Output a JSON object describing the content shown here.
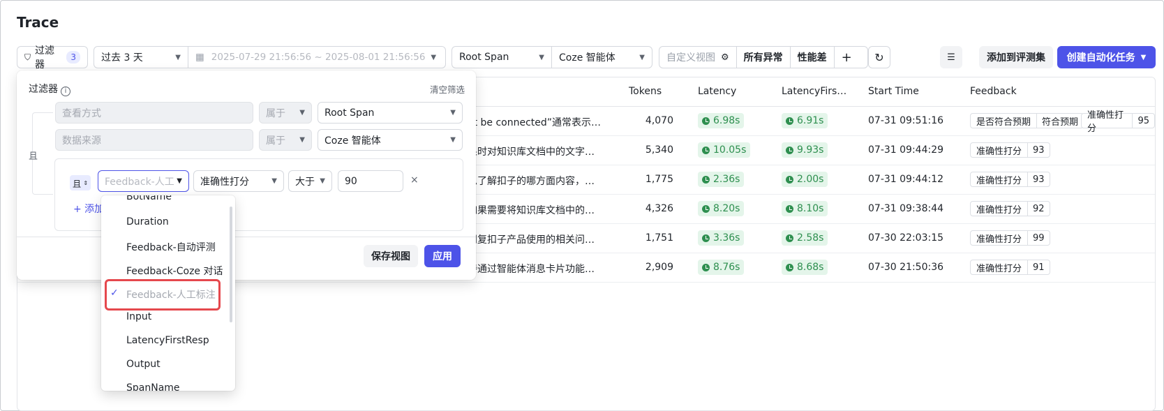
{
  "page": {
    "title": "Trace"
  },
  "toolbar": {
    "filter_label": "过滤器",
    "filter_count": "3",
    "range": "过去 3 天",
    "date_range": "2025-07-29 21:56:56 ~ 2025-08-01 21:56:56",
    "span_type": "Root Span",
    "source": "Coze 智能体",
    "custom_view_placeholder": "自定义视图",
    "view_all_errors": "所有异常",
    "view_perf": "性能差",
    "add_eval": "添加到评测集",
    "create_task": "创建自动化任务"
  },
  "table": {
    "columns": [
      "Tokens",
      "Latency",
      "LatencyFirs…",
      "Start Time",
      "Feedback"
    ],
    "rows": [
      {
        "input": "ot be connected”通常表示…",
        "tokens": "4,070",
        "latency": "6.98s",
        "latency_first": "6.91s",
        "start": "07-31 09:51:16",
        "feedback": [
          {
            "k": "是否符合预期",
            "v": "符合预期"
          },
          {
            "k": "准确性打分",
            "v": "95"
          }
        ]
      },
      {
        "input": "果时对知识库文档中的文字…",
        "tokens": "5,340",
        "latency": "10.05s",
        "latency_first": "9.93s",
        "start": "07-31 09:44:29",
        "feedback": [
          {
            "k": "准确性打分",
            "v": "93"
          }
        ]
      },
      {
        "input": "思了解扣子的哪方面内容，…",
        "tokens": "1,775",
        "latency": "2.36s",
        "latency_first": "2.00s",
        "start": "07-31 09:44:12",
        "feedback": [
          {
            "k": "准确性打分",
            "v": "93"
          }
        ]
      },
      {
        "input": "如果需要将知识库文档中的…",
        "tokens": "4,326",
        "latency": "8.20s",
        "latency_first": "8.10s",
        "start": "07-31 09:38:44",
        "feedback": [
          {
            "k": "准确性打分",
            "v": "92"
          }
        ]
      },
      {
        "input": "问复扣子产品使用的相关问…",
        "tokens": "1,751",
        "latency": "3.36s",
        "latency_first": "2.58s",
        "start": "07-30 22:03:15",
        "feedback": [
          {
            "k": "准确性打分",
            "v": "99"
          }
        ]
      },
      {
        "input": "持通过智能体消息卡片功能…",
        "tokens": "2,909",
        "latency": "8.76s",
        "latency_first": "8.68s",
        "start": "07-30 21:50:36",
        "feedback": [
          {
            "k": "准确性打分",
            "v": "91"
          }
        ]
      }
    ]
  },
  "filter": {
    "title": "过滤器",
    "clear": "清空筛选",
    "and_label": "且",
    "cond1": {
      "field": "查看方式",
      "op": "属于",
      "value": "Root Span"
    },
    "cond2": {
      "field": "数据来源",
      "op": "属于",
      "value": "Coze 智能体"
    },
    "sub": {
      "and_chip": "且",
      "field": "Feedback-人工",
      "metric": "准确性打分",
      "op": "大于",
      "value": "90",
      "remove": "×",
      "add": "+ 添加"
    },
    "save_view": "保存视图",
    "apply": "应用"
  },
  "dropdown": {
    "items": [
      "BotName",
      "Duration",
      "Feedback-自动评测",
      "Feedback-Coze 对话",
      "Feedback-人工标注",
      "Input",
      "LatencyFirstResp",
      "Output",
      "SpanName"
    ],
    "selected": "Feedback-人工标注"
  },
  "colors": {
    "accent": "#4d53e8",
    "success_bg": "#e4f5ea",
    "success_fg": "#2e8f4f",
    "highlight": "#e5484d"
  }
}
